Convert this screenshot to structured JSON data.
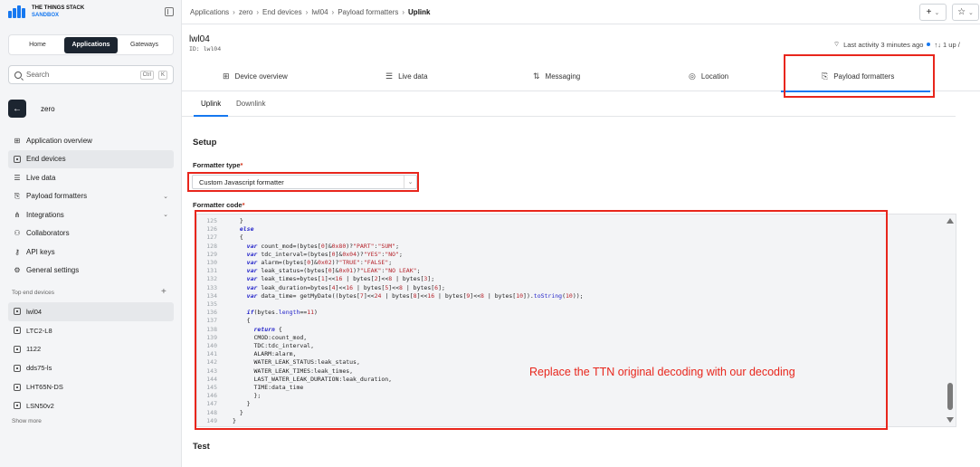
{
  "logo": {
    "line1": "THE THINGS STACK",
    "line2": "SANDBOX"
  },
  "colors": {
    "accent": "#1678f0",
    "highlight": "#e8261c",
    "dark": "#1c2530"
  },
  "segmented": [
    {
      "label": "Home",
      "active": false
    },
    {
      "label": "Applications",
      "active": true
    },
    {
      "label": "Gateways",
      "active": false
    }
  ],
  "search": {
    "placeholder": "Search",
    "shortcut_ctrl": "Ctrl",
    "shortcut_key": "K"
  },
  "application": {
    "name": "zero"
  },
  "nav": [
    {
      "label": "Application overview",
      "icon": "grid-icon",
      "active": false
    },
    {
      "label": "End devices",
      "icon": "chip-icon",
      "active": true
    },
    {
      "label": "Live data",
      "icon": "list-icon",
      "active": false
    },
    {
      "label": "Payload formatters",
      "icon": "code-icon",
      "active": false,
      "chevron": true
    },
    {
      "label": "Integrations",
      "icon": "fork-icon",
      "active": false,
      "chevron": true
    },
    {
      "label": "Collaborators",
      "icon": "people-icon",
      "active": false
    },
    {
      "label": "API keys",
      "icon": "key-icon",
      "active": false
    },
    {
      "label": "General settings",
      "icon": "gear-icon",
      "active": false
    }
  ],
  "top_devices": {
    "label": "Top end devices",
    "items": [
      "lwl04",
      "LTC2-L8",
      "1122",
      "dds75-ls",
      "LHT65N-DS",
      "LSN50v2"
    ],
    "show_more": "Show more"
  },
  "breadcrumbs": [
    "Applications",
    "zero",
    "End devices",
    "lwl04",
    "Payload formatters",
    "Uplink"
  ],
  "toolbar": {
    "add": "+",
    "star": "☆"
  },
  "device": {
    "name": "lwl04",
    "id_label": "ID: lwl04",
    "activity": "Last activity 3 minutes ago",
    "uplinks": "↑↓ 1 up /"
  },
  "tabs": [
    {
      "label": "Device overview",
      "icon": "grid-icon",
      "glyph": "⊞"
    },
    {
      "label": "Live data",
      "icon": "list-icon",
      "glyph": "☰"
    },
    {
      "label": "Messaging",
      "icon": "arrows-icon",
      "glyph": "⇅"
    },
    {
      "label": "Location",
      "icon": "pin-icon",
      "glyph": "◎"
    },
    {
      "label": "Payload formatters",
      "icon": "code-icon",
      "glyph": "⎘"
    }
  ],
  "subtabs": [
    "Uplink",
    "Downlink"
  ],
  "setup": {
    "heading": "Setup",
    "formatter_type_label": "Formatter type",
    "formatter_type_value": "Custom Javascript formatter",
    "formatter_code_label": "Formatter code",
    "required_mark": "*"
  },
  "code_lines": [
    {
      "n": "125",
      "html": "  }"
    },
    {
      "n": "126",
      "html": "  <span class=\"kw\">else</span>"
    },
    {
      "n": "127",
      "html": "  {"
    },
    {
      "n": "128",
      "html": "    <span class=\"kw\">var</span> count_mod=(bytes[<span class=\"num\">0</span>]&amp;<span class=\"num\">0x80</span>)?<span class=\"str\">\"PART\"</span>:<span class=\"str\">\"SUM\"</span>;"
    },
    {
      "n": "129",
      "html": "    <span class=\"kw\">var</span> tdc_interval=(bytes[<span class=\"num\">0</span>]&amp;<span class=\"num\">0x04</span>)?<span class=\"str\">\"YES\"</span>:<span class=\"str\">\"NO\"</span>;"
    },
    {
      "n": "130",
      "html": "    <span class=\"kw\">var</span> alarm=(bytes[<span class=\"num\">0</span>]&amp;<span class=\"num\">0x02</span>)?<span class=\"str\">\"TRUE\"</span>:<span class=\"str\">\"FALSE\"</span>;"
    },
    {
      "n": "131",
      "html": "    <span class=\"kw\">var</span> leak_status=(bytes[<span class=\"num\">0</span>]&amp;<span class=\"num\">0x01</span>)?<span class=\"str\">\"LEAK\"</span>:<span class=\"str\">\"NO LEAK\"</span>;"
    },
    {
      "n": "132",
      "html": "    <span class=\"kw\">var</span> leak_times=bytes[<span class=\"num\">1</span>]&lt;&lt;<span class=\"num\">16</span> | bytes[<span class=\"num\">2</span>]&lt;&lt;<span class=\"num\">8</span> | bytes[<span class=\"num\">3</span>];"
    },
    {
      "n": "133",
      "html": "    <span class=\"kw\">var</span> leak_duration=bytes[<span class=\"num\">4</span>]&lt;&lt;<span class=\"num\">16</span> | bytes[<span class=\"num\">5</span>]&lt;&lt;<span class=\"num\">8</span> | bytes[<span class=\"num\">6</span>];"
    },
    {
      "n": "134",
      "html": "    <span class=\"kw\">var</span> data_time= getMyDate((bytes[<span class=\"num\">7</span>]&lt;&lt;<span class=\"num\">24</span> | bytes[<span class=\"num\">8</span>]&lt;&lt;<span class=\"num\">16</span> | bytes[<span class=\"num\">9</span>]&lt;&lt;<span class=\"num\">8</span> | bytes[<span class=\"num\">10</span>]).<span class=\"fn\">toString</span>(<span class=\"num\">10</span>));"
    },
    {
      "n": "135",
      "html": ""
    },
    {
      "n": "136",
      "html": "    <span class=\"kw\">if</span>(bytes.<span class=\"fn\">length</span>==<span class=\"num\">11</span>)"
    },
    {
      "n": "137",
      "html": "    {"
    },
    {
      "n": "138",
      "html": "      <span class=\"kw\">return</span> {"
    },
    {
      "n": "139",
      "html": "      CMOD:count_mod,"
    },
    {
      "n": "140",
      "html": "      TDC:tdc_interval,"
    },
    {
      "n": "141",
      "html": "      ALARM:alarm,"
    },
    {
      "n": "142",
      "html": "      WATER_LEAK_STATUS:leak_status,"
    },
    {
      "n": "143",
      "html": "      WATER_LEAK_TIMES:leak_times,"
    },
    {
      "n": "144",
      "html": "      LAST_WATER_LEAK_DURATION:leak_duration,"
    },
    {
      "n": "145",
      "html": "      TIME:data_time"
    },
    {
      "n": "146",
      "html": "      };"
    },
    {
      "n": "147",
      "html": "    }"
    },
    {
      "n": "148",
      "html": "  }"
    },
    {
      "n": "149",
      "html": "}"
    }
  ],
  "annotation": "Replace the TTN original decoding with our decoding",
  "test": {
    "heading": "Test"
  }
}
